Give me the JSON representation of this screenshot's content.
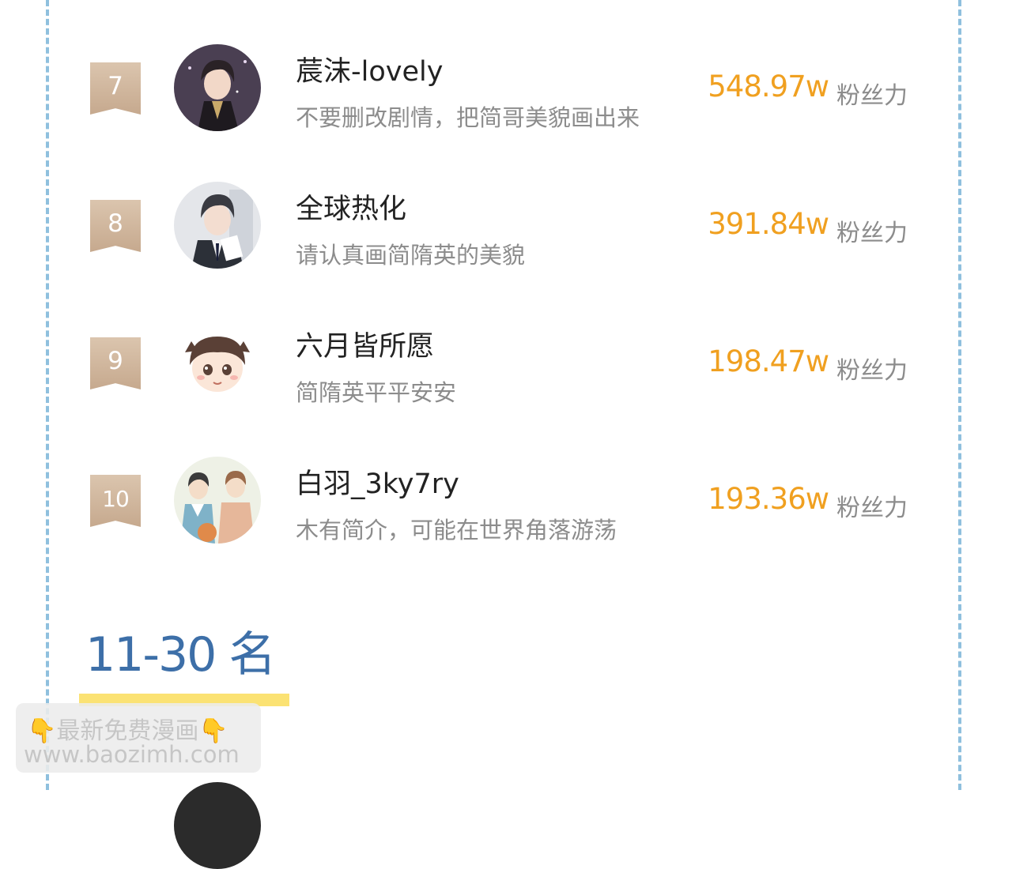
{
  "ranking": {
    "rows": [
      {
        "rank": "7",
        "name": "莀沫-lovely",
        "bio": "不要删改剧情，把简哥美貌画出来",
        "fan_value": "548.97w",
        "fan_label": "粉丝力"
      },
      {
        "rank": "8",
        "name": "全球热化",
        "bio": "请认真画简隋英的美貌",
        "fan_value": "391.84w",
        "fan_label": "粉丝力"
      },
      {
        "rank": "9",
        "name": "六月皆所愿",
        "bio": "简隋英平平安安",
        "fan_value": "198.47w",
        "fan_label": "粉丝力"
      },
      {
        "rank": "10",
        "name": "白羽_3ky7ry",
        "bio": "木有简介，可能在世界角落游荡",
        "fan_value": "193.36w",
        "fan_label": "粉丝力"
      }
    ]
  },
  "section": {
    "title": "11-30 名"
  },
  "watermark": {
    "line1": "最新免费漫画",
    "line2": "www.baozimh.com"
  },
  "colors": {
    "accent_value": "#f0a020",
    "badge": "#c6a98e",
    "section_title": "#3d6fa8",
    "underline": "#fbe273",
    "dash_border": "#8fc0de"
  },
  "icons": {
    "avatar": "user-avatar-illustration",
    "pointing_hand": "backhand-index-pointing-down-emoji"
  }
}
